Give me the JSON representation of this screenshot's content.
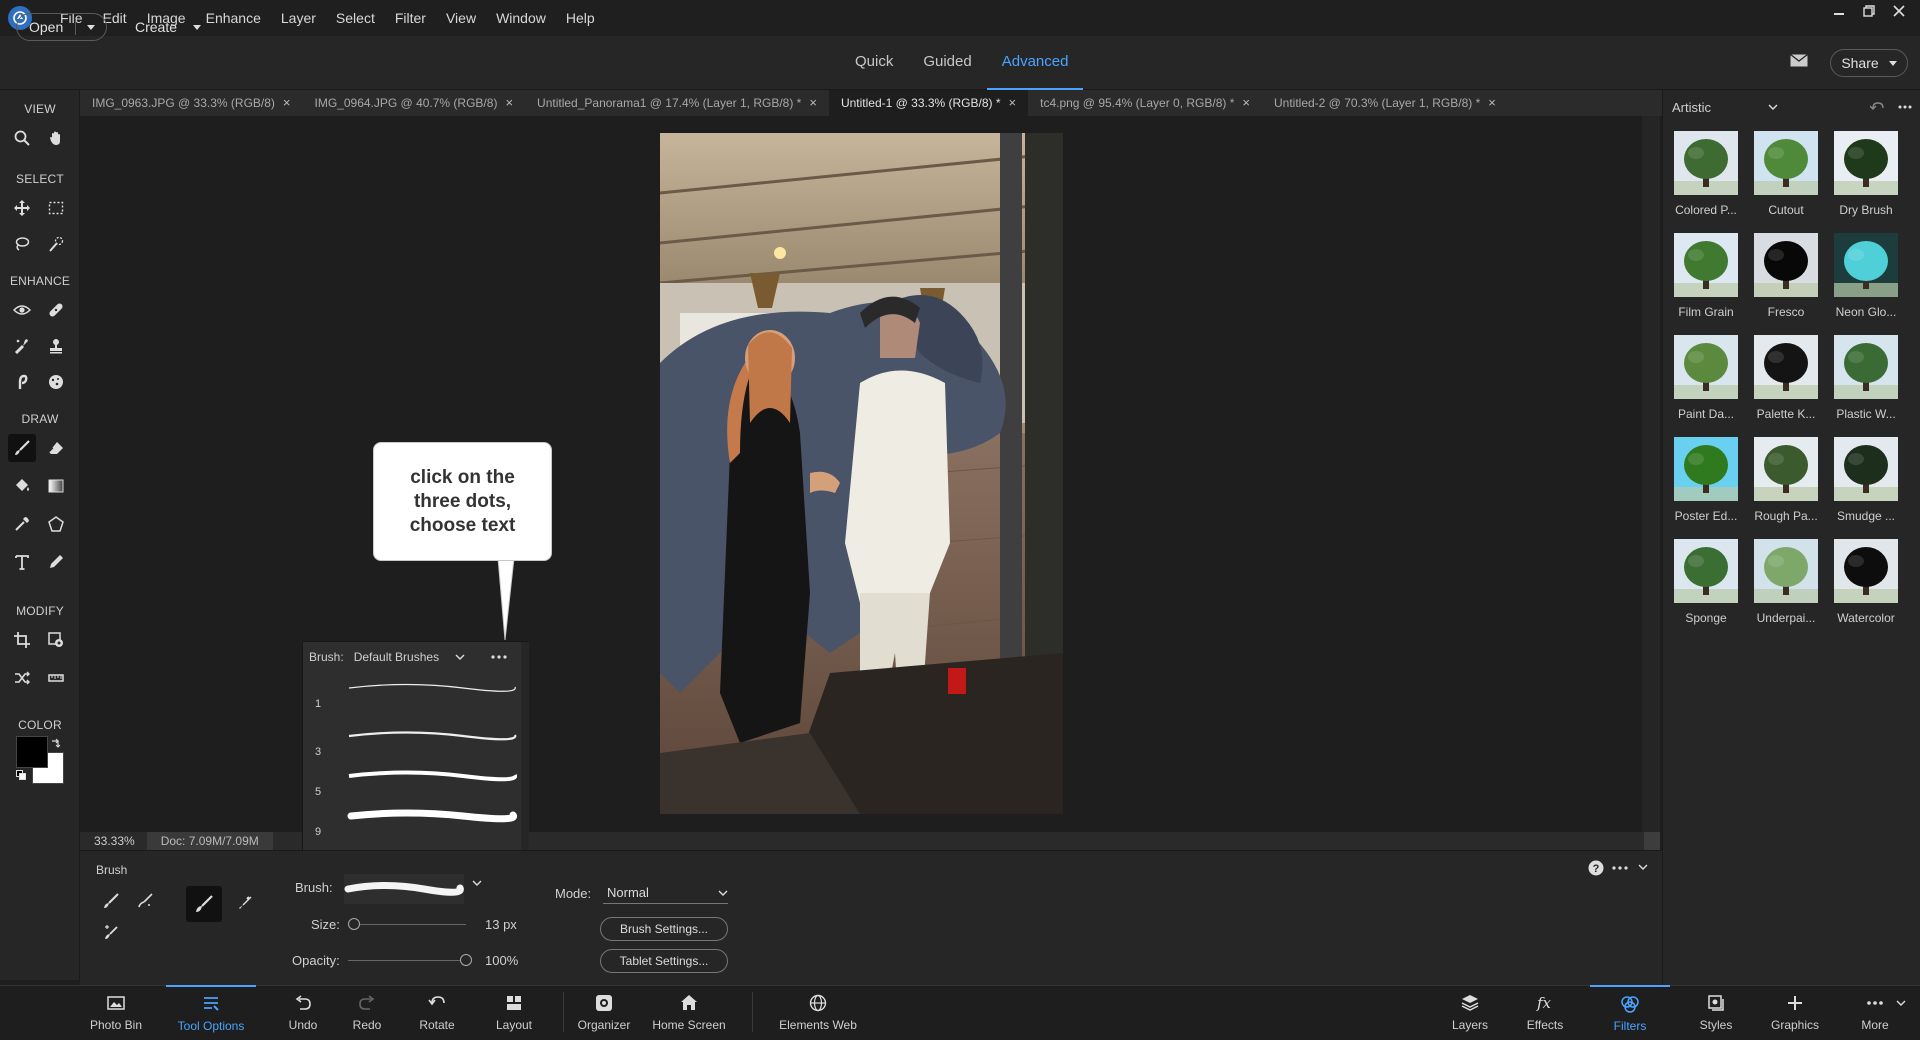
{
  "menubar": {
    "items": [
      "File",
      "Edit",
      "Image",
      "Enhance",
      "Layer",
      "Select",
      "Filter",
      "View",
      "Window",
      "Help"
    ]
  },
  "topbar": {
    "open_label": "Open",
    "create_label": "Create",
    "modes": [
      "Quick",
      "Guided",
      "Advanced"
    ],
    "active_mode": "Advanced",
    "share_label": "Share"
  },
  "toolbox": {
    "sections": [
      "VIEW",
      "SELECT",
      "ENHANCE",
      "DRAW",
      "MODIFY",
      "COLOR"
    ]
  },
  "doc_tabs": [
    {
      "label": "IMG_0963.JPG @ 33.3% (RGB/8)",
      "active": false
    },
    {
      "label": "IMG_0964.JPG @ 40.7% (RGB/8)",
      "active": false
    },
    {
      "label": "Untitled_Panorama1 @ 17.4% (Layer 1, RGB/8) *",
      "active": false
    },
    {
      "label": "Untitled-1 @ 33.3% (RGB/8) *",
      "active": true
    },
    {
      "label": "tc4.png @ 95.4% (Layer 0, RGB/8) *",
      "active": false
    },
    {
      "label": "Untitled-2 @ 70.3% (Layer 1, RGB/8) *",
      "active": false
    }
  ],
  "status": {
    "zoom": "33.33%",
    "doc": "Doc: 7.09M/7.09M"
  },
  "callout": {
    "text": "click on the three dots, choose text"
  },
  "brush_popup": {
    "label": "Brush:",
    "library": "Default Brushes",
    "sizes": [
      "1",
      "3",
      "5",
      "9"
    ]
  },
  "tool_options": {
    "title": "Brush",
    "brush_label": "Brush:",
    "size_label": "Size:",
    "size_value": "13 px",
    "size_fraction": 0.05,
    "opacity_label": "Opacity:",
    "opacity_value": "100%",
    "opacity_fraction": 1.0,
    "mode_label": "Mode:",
    "mode_value": "Normal",
    "brush_settings_label": "Brush Settings...",
    "tablet_settings_label": "Tablet Settings..."
  },
  "taskbar": {
    "left": [
      {
        "label": "Photo Bin",
        "icon": "photo-bin-icon",
        "active": false
      },
      {
        "label": "Tool Options",
        "icon": "tool-options-icon",
        "active": true
      },
      {
        "label": "Undo",
        "icon": "undo-icon",
        "active": false
      },
      {
        "label": "Redo",
        "icon": "redo-icon",
        "active": false
      },
      {
        "label": "Rotate",
        "icon": "rotate-icon",
        "active": false
      },
      {
        "label": "Layout",
        "icon": "layout-icon",
        "active": false
      },
      {
        "label": "Organizer",
        "icon": "organizer-icon",
        "active": false
      },
      {
        "label": "Home Screen",
        "icon": "home-icon",
        "active": false
      },
      {
        "label": "Elements Web",
        "icon": "globe-icon",
        "active": false
      }
    ],
    "right": [
      {
        "label": "Layers",
        "icon": "layers-icon",
        "active": false
      },
      {
        "label": "Effects",
        "icon": "fx-icon",
        "active": false
      },
      {
        "label": "Filters",
        "icon": "filters-icon",
        "active": true
      },
      {
        "label": "Styles",
        "icon": "styles-icon",
        "active": false
      },
      {
        "label": "Graphics",
        "icon": "plus-icon",
        "active": false
      },
      {
        "label": "More",
        "icon": "more-icon",
        "active": false
      }
    ]
  },
  "filters_panel": {
    "category": "Artistic",
    "items": [
      {
        "name": "Colored P...",
        "bg": "#dfe6ee",
        "tree": "#3d6b32"
      },
      {
        "name": "Cutout",
        "bg": "#cfe3f0",
        "tree": "#4f8a3a"
      },
      {
        "name": "Dry Brush",
        "bg": "#e8eef3",
        "tree": "#1f3a1a"
      },
      {
        "name": "Film Grain",
        "bg": "#dde8f2",
        "tree": "#3f7a30"
      },
      {
        "name": "Fresco",
        "bg": "#d9dde2",
        "tree": "#080808"
      },
      {
        "name": "Neon Glo...",
        "bg": "#1d3d3d",
        "tree": "#4fd0d8"
      },
      {
        "name": "Paint Da...",
        "bg": "#d9e6ee",
        "tree": "#5b8a3e"
      },
      {
        "name": "Palette K...",
        "bg": "#e4e9ee",
        "tree": "#141414"
      },
      {
        "name": "Plastic W...",
        "bg": "#d6e4ee",
        "tree": "#3a6b34"
      },
      {
        "name": "Poster Ed...",
        "bg": "#6ad0f0",
        "tree": "#2f7a1e"
      },
      {
        "name": "Rough Pa...",
        "bg": "#e6ebef",
        "tree": "#3b5a2e"
      },
      {
        "name": "Smudge ...",
        "bg": "#e3e9ee",
        "tree": "#1e2e1c"
      },
      {
        "name": "Sponge",
        "bg": "#dbe6ee",
        "tree": "#3b6e33"
      },
      {
        "name": "Underpai...",
        "bg": "#d2e2ea",
        "tree": "#7ea86a"
      },
      {
        "name": "Watercolor",
        "bg": "#e1e6ea",
        "tree": "#0d0d0d"
      }
    ]
  },
  "colors": {
    "accent": "#4aa3ff",
    "foreground": "#000000",
    "background": "#ffffff"
  }
}
